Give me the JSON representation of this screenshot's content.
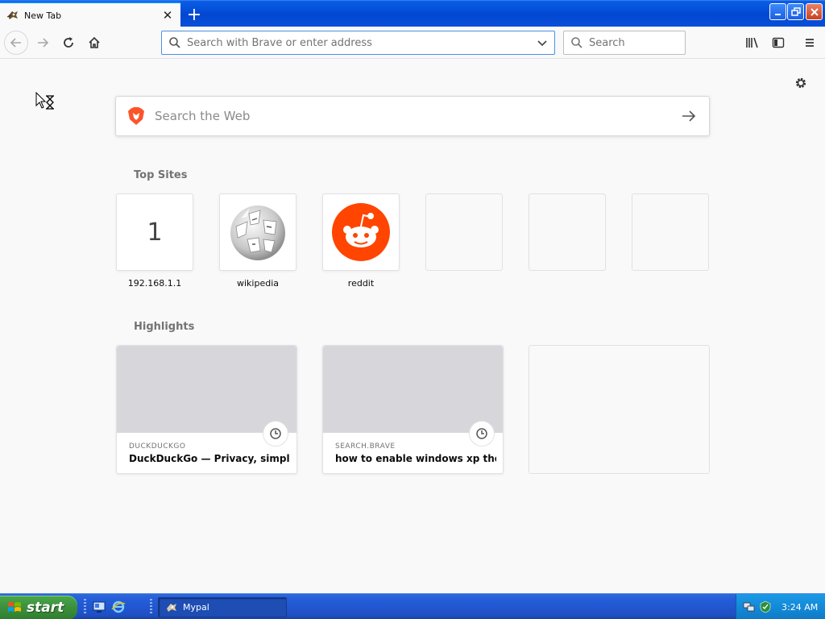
{
  "browser": {
    "tab": {
      "title": "New Tab",
      "close_glyph": "✕",
      "favicon": "mypal-icon"
    },
    "new_tab_glyph": "+",
    "urlbar": {
      "placeholder": "Search with Brave or enter address"
    },
    "searchbar": {
      "placeholder": "Search"
    }
  },
  "newtab": {
    "search_placeholder": "Search the Web",
    "top_sites_title": "Top Sites",
    "top_sites": [
      {
        "label": "192.168.1.1",
        "tile_text": "1",
        "icon": "letter"
      },
      {
        "label": "wikipedia",
        "icon": "wikipedia-icon"
      },
      {
        "label": "reddit",
        "icon": "reddit-icon"
      },
      {
        "label": "",
        "icon": "empty"
      },
      {
        "label": "",
        "icon": "empty"
      },
      {
        "label": "",
        "icon": "empty"
      }
    ],
    "highlights_title": "Highlights",
    "highlights": [
      {
        "host": "DUCKDUCKGO",
        "title": "DuckDuckGo — Privacy, simplifi..."
      },
      {
        "host": "SEARCH.BRAVE",
        "title": "how to enable windows xp the..."
      },
      {
        "host": "",
        "title": ""
      }
    ]
  },
  "taskbar": {
    "start_label": "start",
    "task_label": "Mypal",
    "clock": "3:24 AM"
  },
  "colors": {
    "accent_blue": "#0a84ff",
    "reddit_orange": "#ff4500",
    "brave_orange": "#fb542b",
    "xp_blue": "#245edb",
    "xp_green": "#3c8f3c"
  }
}
